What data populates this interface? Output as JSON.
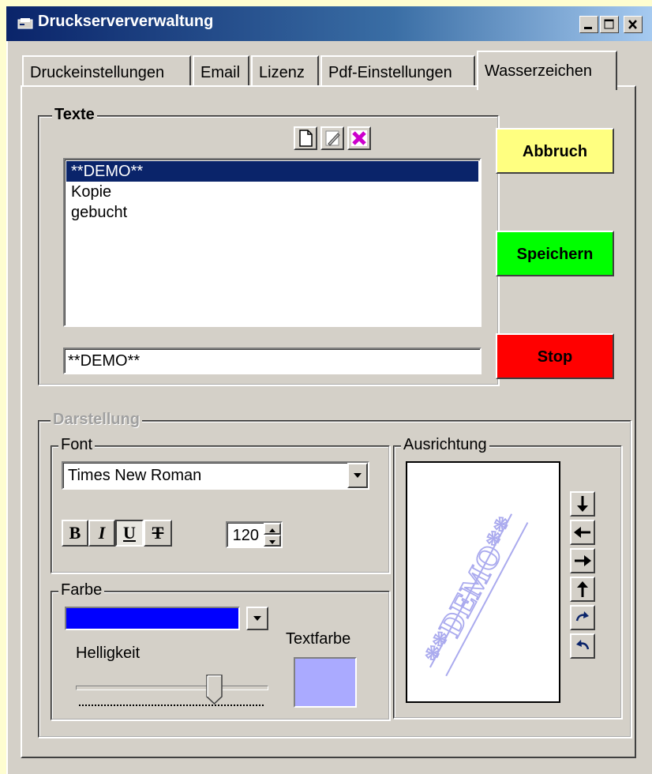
{
  "window": {
    "title": "Druckserververwaltung"
  },
  "tabs": [
    {
      "label": "Druckeinstellungen"
    },
    {
      "label": "Email"
    },
    {
      "label": "Lizenz"
    },
    {
      "label": "Pdf-Einstellungen"
    },
    {
      "label": "Wasserzeichen"
    }
  ],
  "texte": {
    "legend": "Texte",
    "items": [
      "**DEMO**",
      "Kopie",
      "gebucht"
    ],
    "selected_index": 0,
    "edit_value": "**DEMO**"
  },
  "buttons": {
    "abbruch": "Abbruch",
    "speichern": "Speichern",
    "stop": "Stop"
  },
  "darstellung": {
    "legend": "Darstellung",
    "font": {
      "legend": "Font",
      "selected": "Times New Roman",
      "bold_label": "B",
      "italic_label": "I",
      "underline_label": "U",
      "strike_label": "T",
      "size": "120"
    },
    "farbe": {
      "legend": "Farbe",
      "selected_color": "#0000ff",
      "helligkeit_label": "Helligkeit",
      "helligkeit_level": 0.75,
      "textfarbe_label": "Textfarbe",
      "textfarbe_color": "#aaaaff"
    },
    "ausrichtung": {
      "legend": "Ausrichtung",
      "preview_text": "**DEMO**",
      "preview_color": "#aaaaee"
    }
  },
  "colors": {
    "abbruch_bg": "#ffff80",
    "speichern_bg": "#00ff00",
    "stop_bg": "#ff0000",
    "selection": "#0a246a",
    "face": "#d4d0c8"
  }
}
